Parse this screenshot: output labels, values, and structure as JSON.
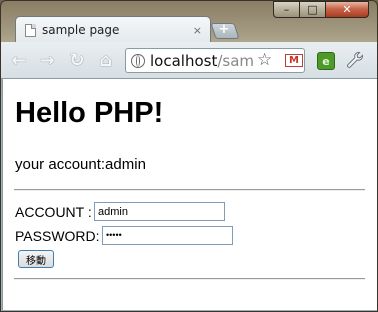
{
  "window": {
    "minimize_glyph": "–",
    "maximize_glyph": "□",
    "close_glyph": "✕"
  },
  "tab": {
    "title": "sample page",
    "close_glyph": "×",
    "new_tab_glyph": "+"
  },
  "toolbar": {
    "back_glyph": "←",
    "forward_glyph": "→",
    "reload_glyph": "↻",
    "home_glyph": "⌂",
    "url_host": "localhost",
    "url_rest": "/sam",
    "star_glyph": "☆",
    "gmail_glyph": "M",
    "evernote_glyph": "e",
    "wrench_glyph": "🔧"
  },
  "page": {
    "heading": "Hello PHP!",
    "account_line": "your account:admin",
    "account_label": "ACCOUNT :",
    "account_value": "admin",
    "password_label": "PASSWORD:",
    "password_value": "•••••",
    "submit_label": "移動"
  },
  "colors": {
    "link_blue": "#3c7fb1",
    "close_red": "#c8664a",
    "evernote_green": "#4d9a2b",
    "gmail_red": "#c3362b"
  }
}
